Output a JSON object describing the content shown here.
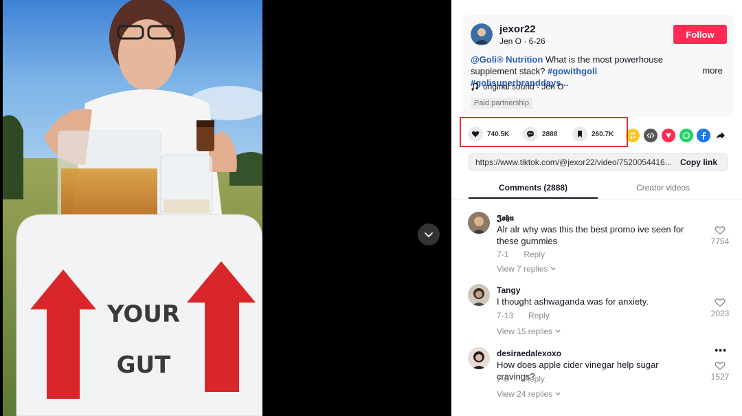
{
  "video": {
    "box_text_top": "YOUR",
    "box_text_bottom": "GUT"
  },
  "author": {
    "username": "jexor22",
    "subline": "Jen O · 6-26",
    "follow_label": "Follow"
  },
  "description": {
    "mention": "@Goli® Nutrition",
    "text": " What is the most powerhouse supplement stack? ",
    "hashtags": "#gowithgoli #golisuperbranddays...",
    "more_label": "more"
  },
  "sound": {
    "label": "original sound - Jen O"
  },
  "paid_label": "Paid partnership",
  "actions": {
    "likes": "740.5K",
    "comments": "2888",
    "saves": "260.7K"
  },
  "share_icons": [
    "repost-icon",
    "embed-icon",
    "send-icon",
    "whatsapp-icon",
    "facebook-icon",
    "share-arrow-icon"
  ],
  "link": {
    "url": "https://www.tiktok.com/@jexor22/video/7520054416...",
    "copy_label": "Copy link"
  },
  "tabs": {
    "comments": "Comments (2888)",
    "creator": "Creator videos"
  },
  "comments": [
    {
      "name": "𝕵𝖔𝖍𝖓",
      "text": "Alr alr why was this the best promo ive seen for these gummies",
      "date": "7-1",
      "reply": "Reply",
      "view": "View 7 replies",
      "likes": "7754"
    },
    {
      "name": "Tangy",
      "text": "I thought ashwaganda was for anxiety.",
      "date": "7-13",
      "reply": "Reply",
      "view": "View 15 replies",
      "likes": "2023"
    },
    {
      "name": "desiraedalexoxo",
      "text": "How does apple cider vinegar help sugar cravings?",
      "date": "7-8",
      "reply": "Reply",
      "view": "View 24 replies",
      "likes": "1527"
    }
  ],
  "colors": {
    "accent": "#fe2c55",
    "link_blue": "#2b5db9",
    "highlight": "#e33131"
  }
}
